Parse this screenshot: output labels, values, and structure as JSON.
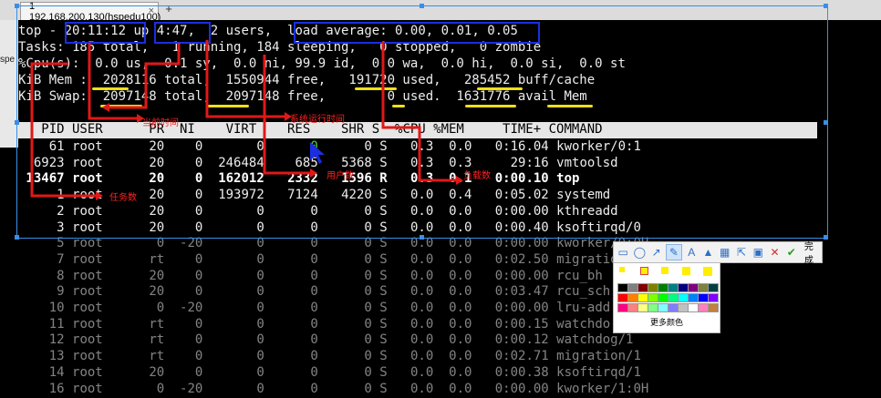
{
  "tab": {
    "title": "1 192.168.200.130(hspedu100)",
    "close": "×",
    "add": "+"
  },
  "left_strip_text": "spe",
  "top": {
    "line1": {
      "cmd": "top - ",
      "time": "20:11:12",
      "up": " up ",
      "uptime": "4:47,",
      "users": "  2 users,  ",
      "load": "load average: 0.00, 0.01, 0.05"
    },
    "line2": "Tasks: 185 total,   1 running, 184 sleeping,   0 stopped,   0 zombie",
    "line3": "%Cpu(s):  0.0 us,  0.1 sy,  0.0 ni, 99.9 id,  0.0 wa,  0.0 hi,  0.0 si,  0.0 st",
    "line4": "KiB Mem :  2028116 total,  1550944 free,   191720 used,   285452 buff/cache",
    "line5": "KiB Swap:  2097148 total,  2097148 free,        0 used.  1631776 avail Mem",
    "header": "   PID USER      PR  NI    VIRT    RES    SHR S  %CPU %MEM     TIME+ COMMAND",
    "rows": [
      {
        "pid": "61",
        "user": "root",
        "pr": "20",
        "ni": "0",
        "virt": "0",
        "res": "0",
        "shr": "0",
        "s": "S",
        "cpu": "0.3",
        "mem": "0.0",
        "time": "0:16.04",
        "cmd": "kworker/0:1"
      },
      {
        "pid": "6923",
        "user": "root",
        "pr": "20",
        "ni": "0",
        "virt": "246484",
        "res": "685",
        "shr": "5368",
        "s": "S",
        "cpu": "0.3",
        "mem": "0.3",
        "time": "29:16",
        "cmd": "vmtoolsd"
      },
      {
        "pid": "13467",
        "user": "root",
        "pr": "20",
        "ni": "0",
        "virt": "162012",
        "res": "2332",
        "shr": "1596",
        "s": "R",
        "cpu": "0.3",
        "mem": "0.1",
        "time": "0:00.10",
        "cmd": "top"
      },
      {
        "pid": "1",
        "user": "root",
        "pr": "20",
        "ni": "0",
        "virt": "193972",
        "res": "7124",
        "shr": "4220",
        "s": "S",
        "cpu": "0.0",
        "mem": "0.4",
        "time": "0:05.02",
        "cmd": "systemd"
      },
      {
        "pid": "2",
        "user": "root",
        "pr": "20",
        "ni": "0",
        "virt": "0",
        "res": "0",
        "shr": "0",
        "s": "S",
        "cpu": "0.0",
        "mem": "0.0",
        "time": "0:00.00",
        "cmd": "kthreadd"
      },
      {
        "pid": "3",
        "user": "root",
        "pr": "20",
        "ni": "0",
        "virt": "0",
        "res": "0",
        "shr": "0",
        "s": "S",
        "cpu": "0.0",
        "mem": "0.0",
        "time": "0:00.40",
        "cmd": "ksoftirqd/0"
      },
      {
        "pid": "5",
        "user": "root",
        "pr": "0",
        "ni": "-20",
        "virt": "0",
        "res": "0",
        "shr": "0",
        "s": "S",
        "cpu": "0.0",
        "mem": "0.0",
        "time": "0:00.00",
        "cmd": "kworker/0:0H"
      },
      {
        "pid": "7",
        "user": "root",
        "pr": "rt",
        "ni": "0",
        "virt": "0",
        "res": "0",
        "shr": "0",
        "s": "S",
        "cpu": "0.0",
        "mem": "0.0",
        "time": "0:02.50",
        "cmd": "migratio"
      },
      {
        "pid": "8",
        "user": "root",
        "pr": "20",
        "ni": "0",
        "virt": "0",
        "res": "0",
        "shr": "0",
        "s": "S",
        "cpu": "0.0",
        "mem": "0.0",
        "time": "0:00.00",
        "cmd": "rcu_bh"
      },
      {
        "pid": "9",
        "user": "root",
        "pr": "20",
        "ni": "0",
        "virt": "0",
        "res": "0",
        "shr": "0",
        "s": "S",
        "cpu": "0.0",
        "mem": "0.0",
        "time": "0:03.47",
        "cmd": "rcu_sch"
      },
      {
        "pid": "10",
        "user": "root",
        "pr": "0",
        "ni": "-20",
        "virt": "0",
        "res": "0",
        "shr": "0",
        "s": "S",
        "cpu": "0.0",
        "mem": "0.0",
        "time": "0:00.00",
        "cmd": "lru-add"
      },
      {
        "pid": "11",
        "user": "root",
        "pr": "rt",
        "ni": "0",
        "virt": "0",
        "res": "0",
        "shr": "0",
        "s": "S",
        "cpu": "0.0",
        "mem": "0.0",
        "time": "0:00.15",
        "cmd": "watchdo"
      },
      {
        "pid": "12",
        "user": "root",
        "pr": "rt",
        "ni": "0",
        "virt": "0",
        "res": "0",
        "shr": "0",
        "s": "S",
        "cpu": "0.0",
        "mem": "0.0",
        "time": "0:00.12",
        "cmd": "watchdog/1"
      },
      {
        "pid": "13",
        "user": "root",
        "pr": "rt",
        "ni": "0",
        "virt": "0",
        "res": "0",
        "shr": "0",
        "s": "S",
        "cpu": "0.0",
        "mem": "0.0",
        "time": "0:02.71",
        "cmd": "migration/1"
      },
      {
        "pid": "14",
        "user": "root",
        "pr": "20",
        "ni": "0",
        "virt": "0",
        "res": "0",
        "shr": "0",
        "s": "S",
        "cpu": "0.0",
        "mem": "0.0",
        "time": "0:00.38",
        "cmd": "ksoftirqd/1"
      },
      {
        "pid": "16",
        "user": "root",
        "pr": "0",
        "ni": "-20",
        "virt": "0",
        "res": "0",
        "shr": "0",
        "s": "S",
        "cpu": "0.0",
        "mem": "0.0",
        "time": "0:00.00",
        "cmd": "kworker/1:0H"
      }
    ]
  },
  "annotations": {
    "current_time": "当前时间",
    "uptime": "系统运行时间",
    "task_count": "任务数",
    "user_count": "用户数",
    "load": "负载数"
  },
  "toolbar": {
    "done": "完成",
    "more_colors": "更多颜色"
  },
  "colors": {
    "blue_box": "#1a2fe0",
    "red_mark": "#e01818",
    "yellow_underline": "#f0e014",
    "palette": [
      "#000000",
      "#808080",
      "#800000",
      "#808000",
      "#008000",
      "#008080",
      "#000080",
      "#800080",
      "#808040",
      "#004040",
      "#ff0000",
      "#ff8000",
      "#ffff00",
      "#80ff00",
      "#00ff00",
      "#00ff80",
      "#00ffff",
      "#0080ff",
      "#0000ff",
      "#8000ff",
      "#ff0080",
      "#ff8080",
      "#ffff80",
      "#80ff80",
      "#80ffff",
      "#8080ff",
      "#c0c0c0",
      "#ffffff",
      "#ff80c0",
      "#c08040"
    ]
  }
}
